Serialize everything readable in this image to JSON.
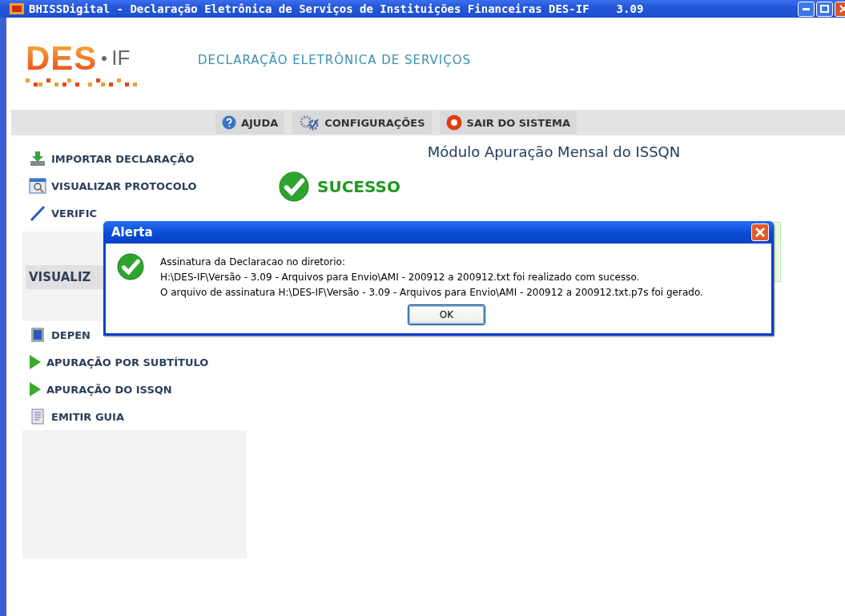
{
  "window": {
    "title": "BHISSDigital - Declaração Eletrônica de Serviços de Instituições Financeiras DES-IF",
    "version": "3.09"
  },
  "header": {
    "logo_main": "DES",
    "logo_sub": "IF",
    "title": "DECLARAÇÃO ELETRÔNICA DE SERVIÇOS"
  },
  "toolbar": [
    {
      "label": "AJUDA",
      "kind": "help"
    },
    {
      "label": "CONFIGURAÇÕES",
      "kind": "settings"
    },
    {
      "label": "SAIR DO SISTEMA",
      "kind": "exit"
    }
  ],
  "sidebar": {
    "top_items": [
      {
        "label": "IMPORTAR DECLARAÇÃO",
        "kind": "import"
      },
      {
        "label": "VISUALIZAR PROTOCOLO",
        "kind": "protocol"
      },
      {
        "label": "VERIFIC",
        "kind": "pen"
      }
    ],
    "section_title": "VISUALIZ",
    "section_items": [
      {
        "label": "DEPEN",
        "kind": "building"
      },
      {
        "label": "APURAÇÃO POR SUBTÍTULO",
        "kind": "play"
      },
      {
        "label": "APURAÇÃO DO ISSQN",
        "kind": "play"
      },
      {
        "label": "EMITIR GUIA",
        "kind": "doc"
      }
    ]
  },
  "main": {
    "title": "Módulo Apuração Mensal do ISSQN",
    "status": "SUCESSO"
  },
  "dialog": {
    "title": "Alerta",
    "lines": [
      "Assinatura da Declaracao no diretorio:",
      "H:\\DES-IF\\Versão - 3.09 - Arquivos para Envio\\AMI - 200912 a 200912.txt foi realizado com sucesso.",
      "O arquivo de assinatura H:\\DES-IF\\Versão - 3.09 - Arquivos para Envio\\AMI - 200912 a 200912.txt.p7s foi gerado."
    ],
    "button": "OK"
  }
}
